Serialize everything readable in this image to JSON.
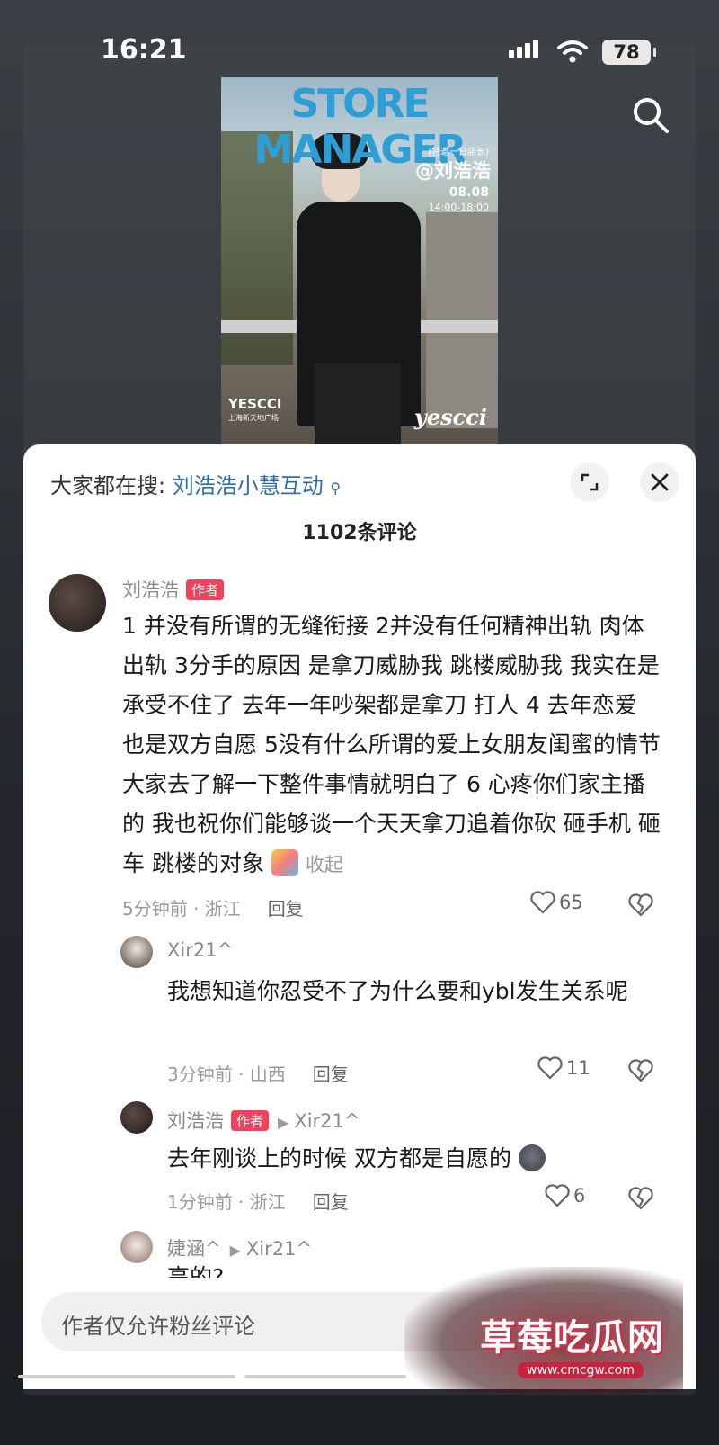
{
  "status_bar": {
    "time": "16:21",
    "battery": "78"
  },
  "poster": {
    "title": "STORE MANAGER",
    "subtitle": "(特邀一日店长)",
    "handle": "@刘浩浩",
    "date": "08.08",
    "time": "14:00-18:00",
    "brand_left": "YESCCI",
    "brand_left_sub": "上海新天地广场",
    "brand_right": "yescci"
  },
  "sheet": {
    "search_prefix": "大家都在搜:",
    "search_keyword": "刘浩浩小慧互动",
    "comment_count": "1102条评论"
  },
  "comments": [
    {
      "user": "刘浩浩",
      "tag": "作者",
      "text": "1 并没有所谓的无缝衔接 2并没有任何精神出轨 肉体出轨 3分手的原因 是拿刀威胁我 跳楼威胁我 我实在是承受不住了 去年一年吵架都是拿刀 打人 4 去年恋爱 也是双方自愿 5没有什么所谓的爱上女朋友闺蜜的情节 大家去了解一下整件事情就明白了 6 心疼你们家主播的 我也祝你们能够谈一个天天拿刀追着你砍 砸手机 砸车 跳楼的对象",
      "collapse": "收起",
      "time_loc": "5分钟前 · 浙江",
      "reply": "回复",
      "likes": "65"
    },
    {
      "user": "Xir21^",
      "text": "我想知道你忍受不了为什么要和ybl发生关系呢",
      "time_loc": "3分钟前 · 山西",
      "reply": "回复",
      "likes": "11"
    },
    {
      "user": "刘浩浩",
      "tag": "作者",
      "reply_to": "Xir21^",
      "text": "去年刚谈上的时候 双方都是自愿的",
      "time_loc": "1分钟前 · 浙江",
      "reply": "回复",
      "likes": "6"
    },
    {
      "user": "婕涵^",
      "reply_to": "Xir21^",
      "text": "高的?"
    }
  ],
  "input": {
    "placeholder": "作者仅允许粉丝评论"
  },
  "watermark": {
    "text": "草莓吃瓜网",
    "url": "www.cmcgw.com"
  },
  "colors": {
    "author_tag": "#f2425b",
    "keyword": "#2f6fa8"
  },
  "icons": [
    "search-icon",
    "expand-icon",
    "close-icon",
    "heart-icon",
    "broken-heart-icon",
    "wifi-icon",
    "signal-icon"
  ]
}
